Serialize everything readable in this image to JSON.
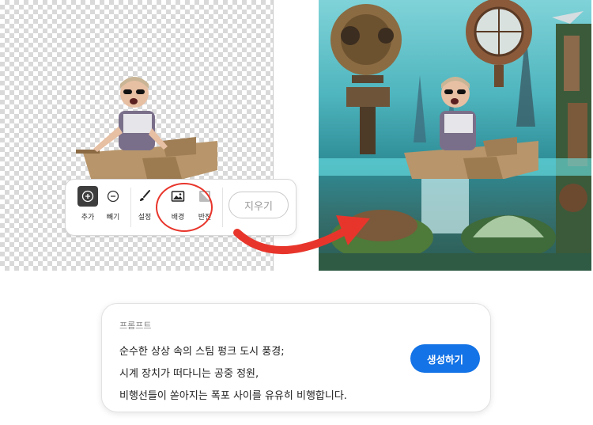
{
  "toolbar": {
    "tools": [
      {
        "label": "추가",
        "icon": "add-brush-icon"
      },
      {
        "label": "빼기",
        "icon": "subtract-brush-icon"
      },
      {
        "label": "설정",
        "icon": "brush-settings-icon"
      },
      {
        "label": "배경",
        "icon": "background-image-icon"
      },
      {
        "label": "반전",
        "icon": "invert-icon"
      }
    ],
    "erase_label": "지우기"
  },
  "prompt": {
    "label": "프롬프트",
    "lines": [
      "순수한 상상 속의 스팀 펑크 도시 풍경;",
      "시계 장치가 떠다니는 공중 정원,",
      "비행선들이 쏟아지는 폭포 사이를 유유히 비행합니다."
    ],
    "generate_label": "생성하기"
  },
  "colors": {
    "accent": "#1473e6",
    "highlight_circle": "#e8352b",
    "arrow": "#e8352b"
  }
}
